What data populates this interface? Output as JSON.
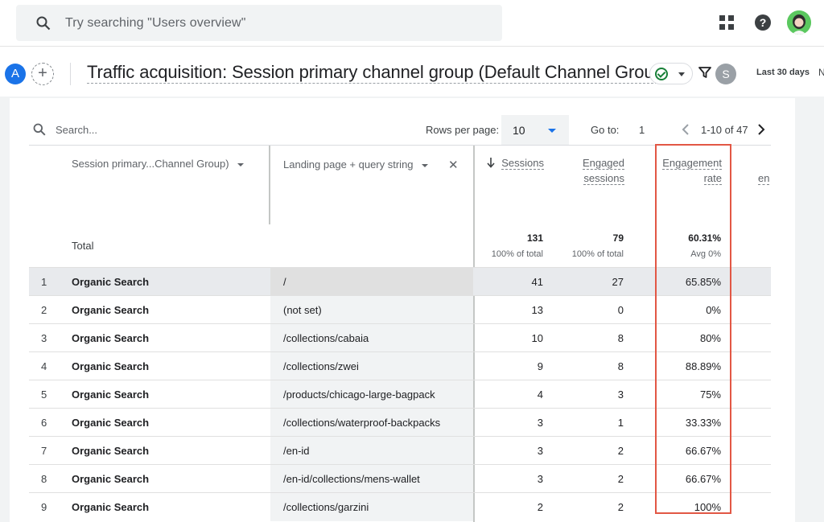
{
  "topbar": {
    "search_placeholder": "Try searching \"Users overview\"",
    "apps_icon": "apps-grid-icon",
    "help_icon": "help-icon",
    "help_glyph": "?",
    "account_icon": "account-avatar"
  },
  "report": {
    "badge_a": "A",
    "add_comparison": "+",
    "title": "Traffic acquisition: Session primary channel group (Default Channel Group)",
    "badge_s": "S",
    "date_range": "Last 30 days",
    "date_range_next": "N"
  },
  "toolbar": {
    "search_placeholder": "Search...",
    "rows_per_page_label": "Rows per page:",
    "rows_per_page_value": "10",
    "goto_label": "Go to:",
    "goto_value": "1",
    "page_range": "1-10 of 47"
  },
  "table": {
    "dim1_header": "Session primary...Channel Group)",
    "dim2_header": "Landing page + query string",
    "metric_headers": {
      "sessions": "Sessions",
      "engaged_1": "Engaged",
      "engaged_2": "sessions",
      "rate_1": "Engagement",
      "rate_2": "rate",
      "next": "en"
    },
    "total_label": "Total",
    "totals": {
      "sessions": "131",
      "sessions_sub": "100% of total",
      "engaged": "79",
      "engaged_sub": "100% of total",
      "rate": "60.31%",
      "rate_sub": "Avg 0%"
    },
    "rows": [
      {
        "idx": "1",
        "channel": "Organic Search",
        "page": "/",
        "sessions": "41",
        "engaged": "27",
        "rate": "65.85%"
      },
      {
        "idx": "2",
        "channel": "Organic Search",
        "page": "(not set)",
        "sessions": "13",
        "engaged": "0",
        "rate": "0%"
      },
      {
        "idx": "3",
        "channel": "Organic Search",
        "page": "/collections/cabaia",
        "sessions": "10",
        "engaged": "8",
        "rate": "80%"
      },
      {
        "idx": "4",
        "channel": "Organic Search",
        "page": "/collections/zwei",
        "sessions": "9",
        "engaged": "8",
        "rate": "88.89%"
      },
      {
        "idx": "5",
        "channel": "Organic Search",
        "page": "/products/chicago-large-bagpack",
        "sessions": "4",
        "engaged": "3",
        "rate": "75%"
      },
      {
        "idx": "6",
        "channel": "Organic Search",
        "page": "/collections/waterproof-backpacks",
        "sessions": "3",
        "engaged": "1",
        "rate": "33.33%"
      },
      {
        "idx": "7",
        "channel": "Organic Search",
        "page": "/en-id",
        "sessions": "3",
        "engaged": "2",
        "rate": "66.67%"
      },
      {
        "idx": "8",
        "channel": "Organic Search",
        "page": "/en-id/collections/mens-wallet",
        "sessions": "3",
        "engaged": "2",
        "rate": "66.67%"
      },
      {
        "idx": "9",
        "channel": "Organic Search",
        "page": "/collections/garzini",
        "sessions": "2",
        "engaged": "2",
        "rate": "100%"
      }
    ]
  },
  "colors": {
    "accent": "#1a73e8",
    "highlight": "#e25745",
    "status_ok": "#188038"
  }
}
